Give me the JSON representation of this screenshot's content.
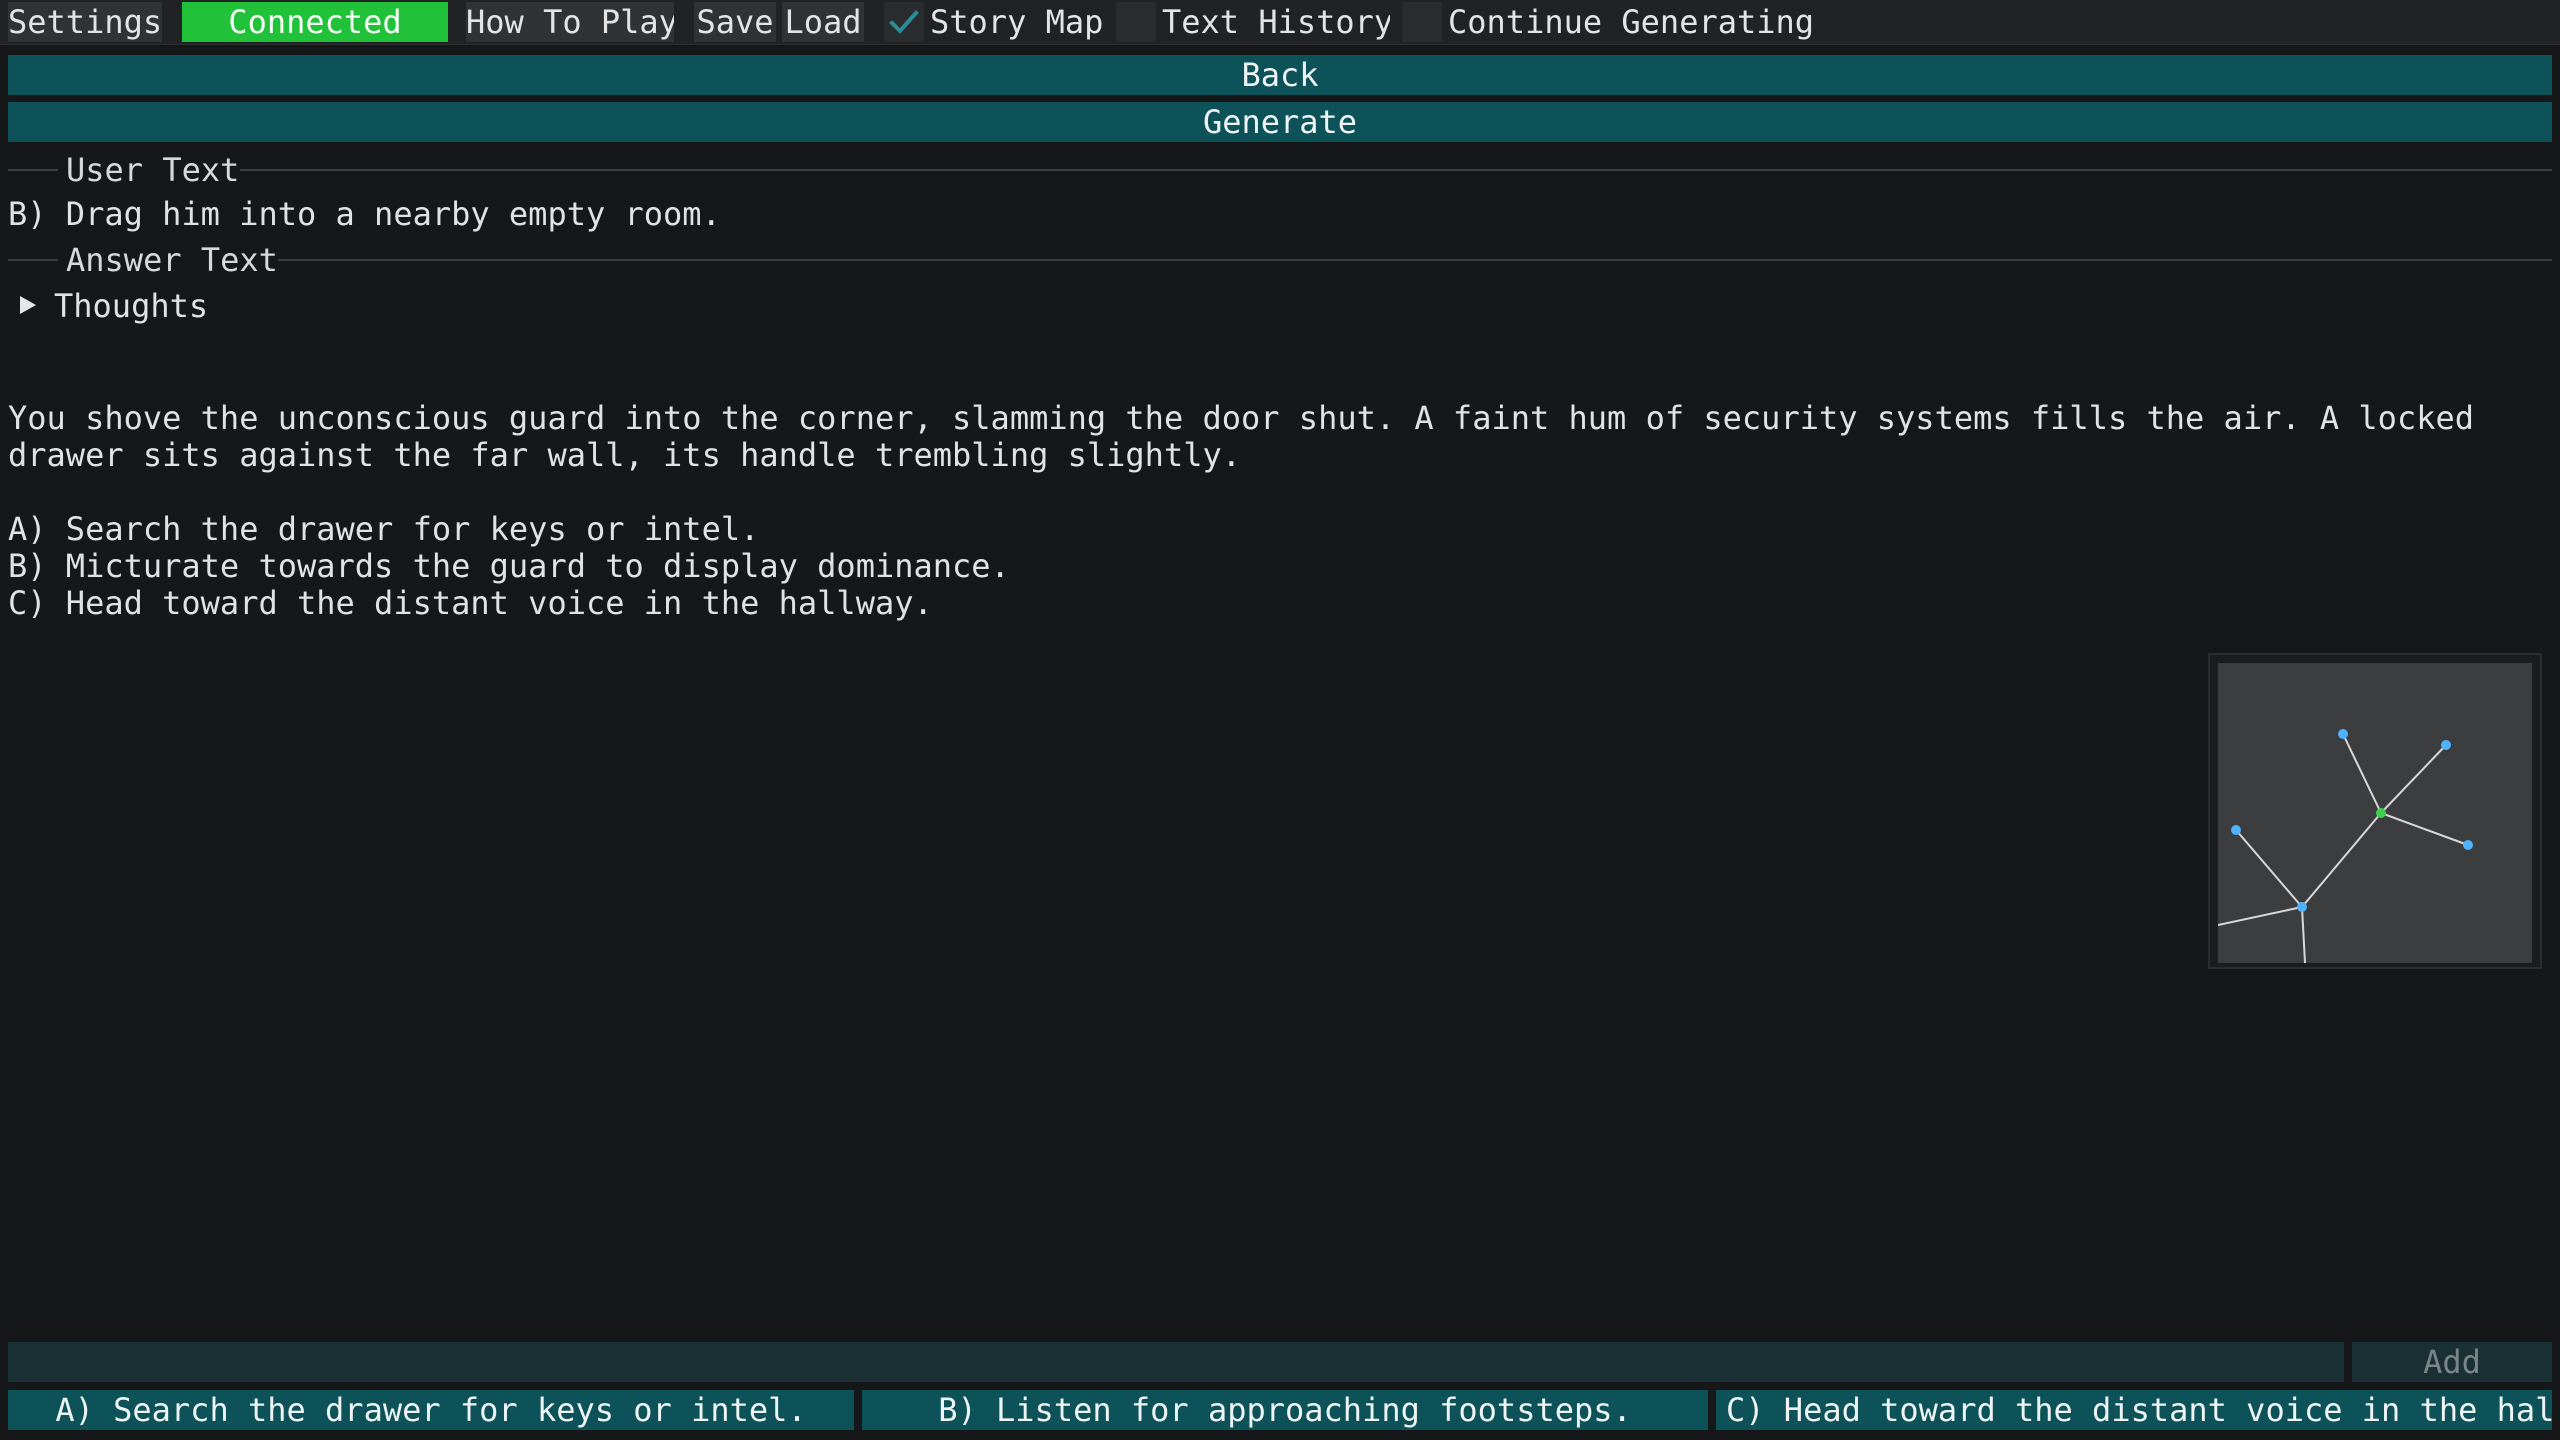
{
  "menu": {
    "settings": "Settings",
    "connected": "Connected",
    "how_to_play": "How To Play",
    "save": "Save",
    "load": "Load",
    "story_map": {
      "label": "Story Map",
      "checked": true
    },
    "text_history": {
      "label": "Text History",
      "checked": false
    },
    "continue_generating": {
      "label": "Continue Generating",
      "checked": false
    },
    "connected_color": "#21c23a"
  },
  "actions": {
    "back": "Back",
    "generate": "Generate"
  },
  "user_section": {
    "label": "User Text",
    "text": "B) Drag him into a nearby empty room."
  },
  "answer_section": {
    "label": "Answer Text",
    "thoughts_label": "Thoughts",
    "paragraph1": "You shove the unconscious guard into the corner, slamming the door shut. A faint hum of security systems fills the air. A locked drawer sits against the far wall, its handle trembling slightly.",
    "option_a": "A) Search the drawer for keys or intel.",
    "option_b": "B) Micturate towards the guard to display dominance.",
    "option_c": "C) Head toward the distant voice in the hallway."
  },
  "story_map": {
    "node_color": "#4fb3ff",
    "current_node_color": "#3fd04f",
    "edge_color": "#d8d8d8"
  },
  "input": {
    "value": "",
    "placeholder": "",
    "add_label": "Add"
  },
  "choices": [
    "A) Search the drawer for keys or intel.",
    "B) Listen for approaching footsteps.",
    "C) Head toward the distant voice in the hallw"
  ],
  "colors": {
    "teal_button": "#0c5258",
    "background": "#161718"
  }
}
